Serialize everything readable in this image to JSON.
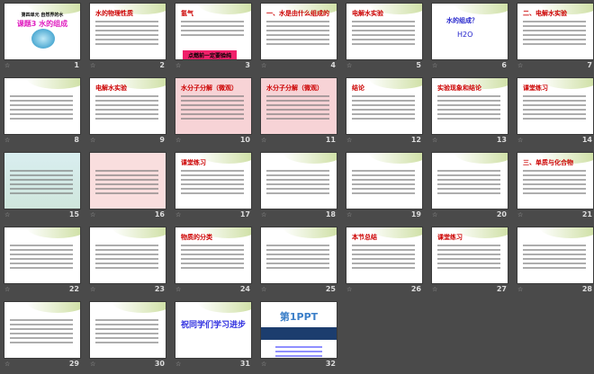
{
  "app": "slide-sorter",
  "slides": [
    {
      "n": "1",
      "style": "green",
      "sub": "第四单元 自然界的水",
      "title": "课题3 水的组成",
      "kind": "cover"
    },
    {
      "n": "2",
      "style": "green",
      "title": "水的物理性质"
    },
    {
      "n": "3",
      "style": "green",
      "title": "氢气",
      "banner": "点燃前一定要验纯"
    },
    {
      "n": "4",
      "style": "green",
      "title": "一、水是由什么组成的"
    },
    {
      "n": "5",
      "style": "green",
      "title": "电解水实验"
    },
    {
      "n": "6",
      "style": "green",
      "title": "水的组成？",
      "formula": "H2O",
      "kind": "formula"
    },
    {
      "n": "7",
      "style": "green",
      "title": "二、电解水实验"
    },
    {
      "n": "8",
      "style": "green",
      "title": ""
    },
    {
      "n": "9",
      "style": "green",
      "title": "电解水实验"
    },
    {
      "n": "10",
      "style": "pink",
      "title": "水分子分解（微观）"
    },
    {
      "n": "11",
      "style": "pink",
      "title": "水分子分解（微观）"
    },
    {
      "n": "12",
      "style": "green",
      "title": "结论"
    },
    {
      "n": "13",
      "style": "green",
      "title": "实验现象和结论"
    },
    {
      "n": "14",
      "style": "green",
      "title": "课堂练习"
    },
    {
      "n": "15",
      "style": "teal",
      "title": ""
    },
    {
      "n": "16",
      "style": "lpink",
      "title": ""
    },
    {
      "n": "17",
      "style": "green",
      "title": "课堂练习"
    },
    {
      "n": "18",
      "style": "green",
      "title": ""
    },
    {
      "n": "19",
      "style": "green",
      "title": ""
    },
    {
      "n": "20",
      "style": "green",
      "title": ""
    },
    {
      "n": "21",
      "style": "green",
      "title": "三、单质与化合物"
    },
    {
      "n": "22",
      "style": "green",
      "title": ""
    },
    {
      "n": "23",
      "style": "green",
      "title": ""
    },
    {
      "n": "24",
      "style": "green",
      "title": "物质的分类"
    },
    {
      "n": "25",
      "style": "green",
      "title": ""
    },
    {
      "n": "26",
      "style": "green",
      "title": "本节总结"
    },
    {
      "n": "27",
      "style": "green",
      "title": "课堂练习"
    },
    {
      "n": "28",
      "style": "green",
      "title": ""
    },
    {
      "n": "29",
      "style": "green",
      "title": ""
    },
    {
      "n": "30",
      "style": "green",
      "title": ""
    },
    {
      "n": "31",
      "style": "green",
      "title": "祝同学们学习进步",
      "kind": "end"
    },
    {
      "n": "32",
      "style": "plain",
      "title": "第1PPT",
      "kind": "logo"
    }
  ]
}
